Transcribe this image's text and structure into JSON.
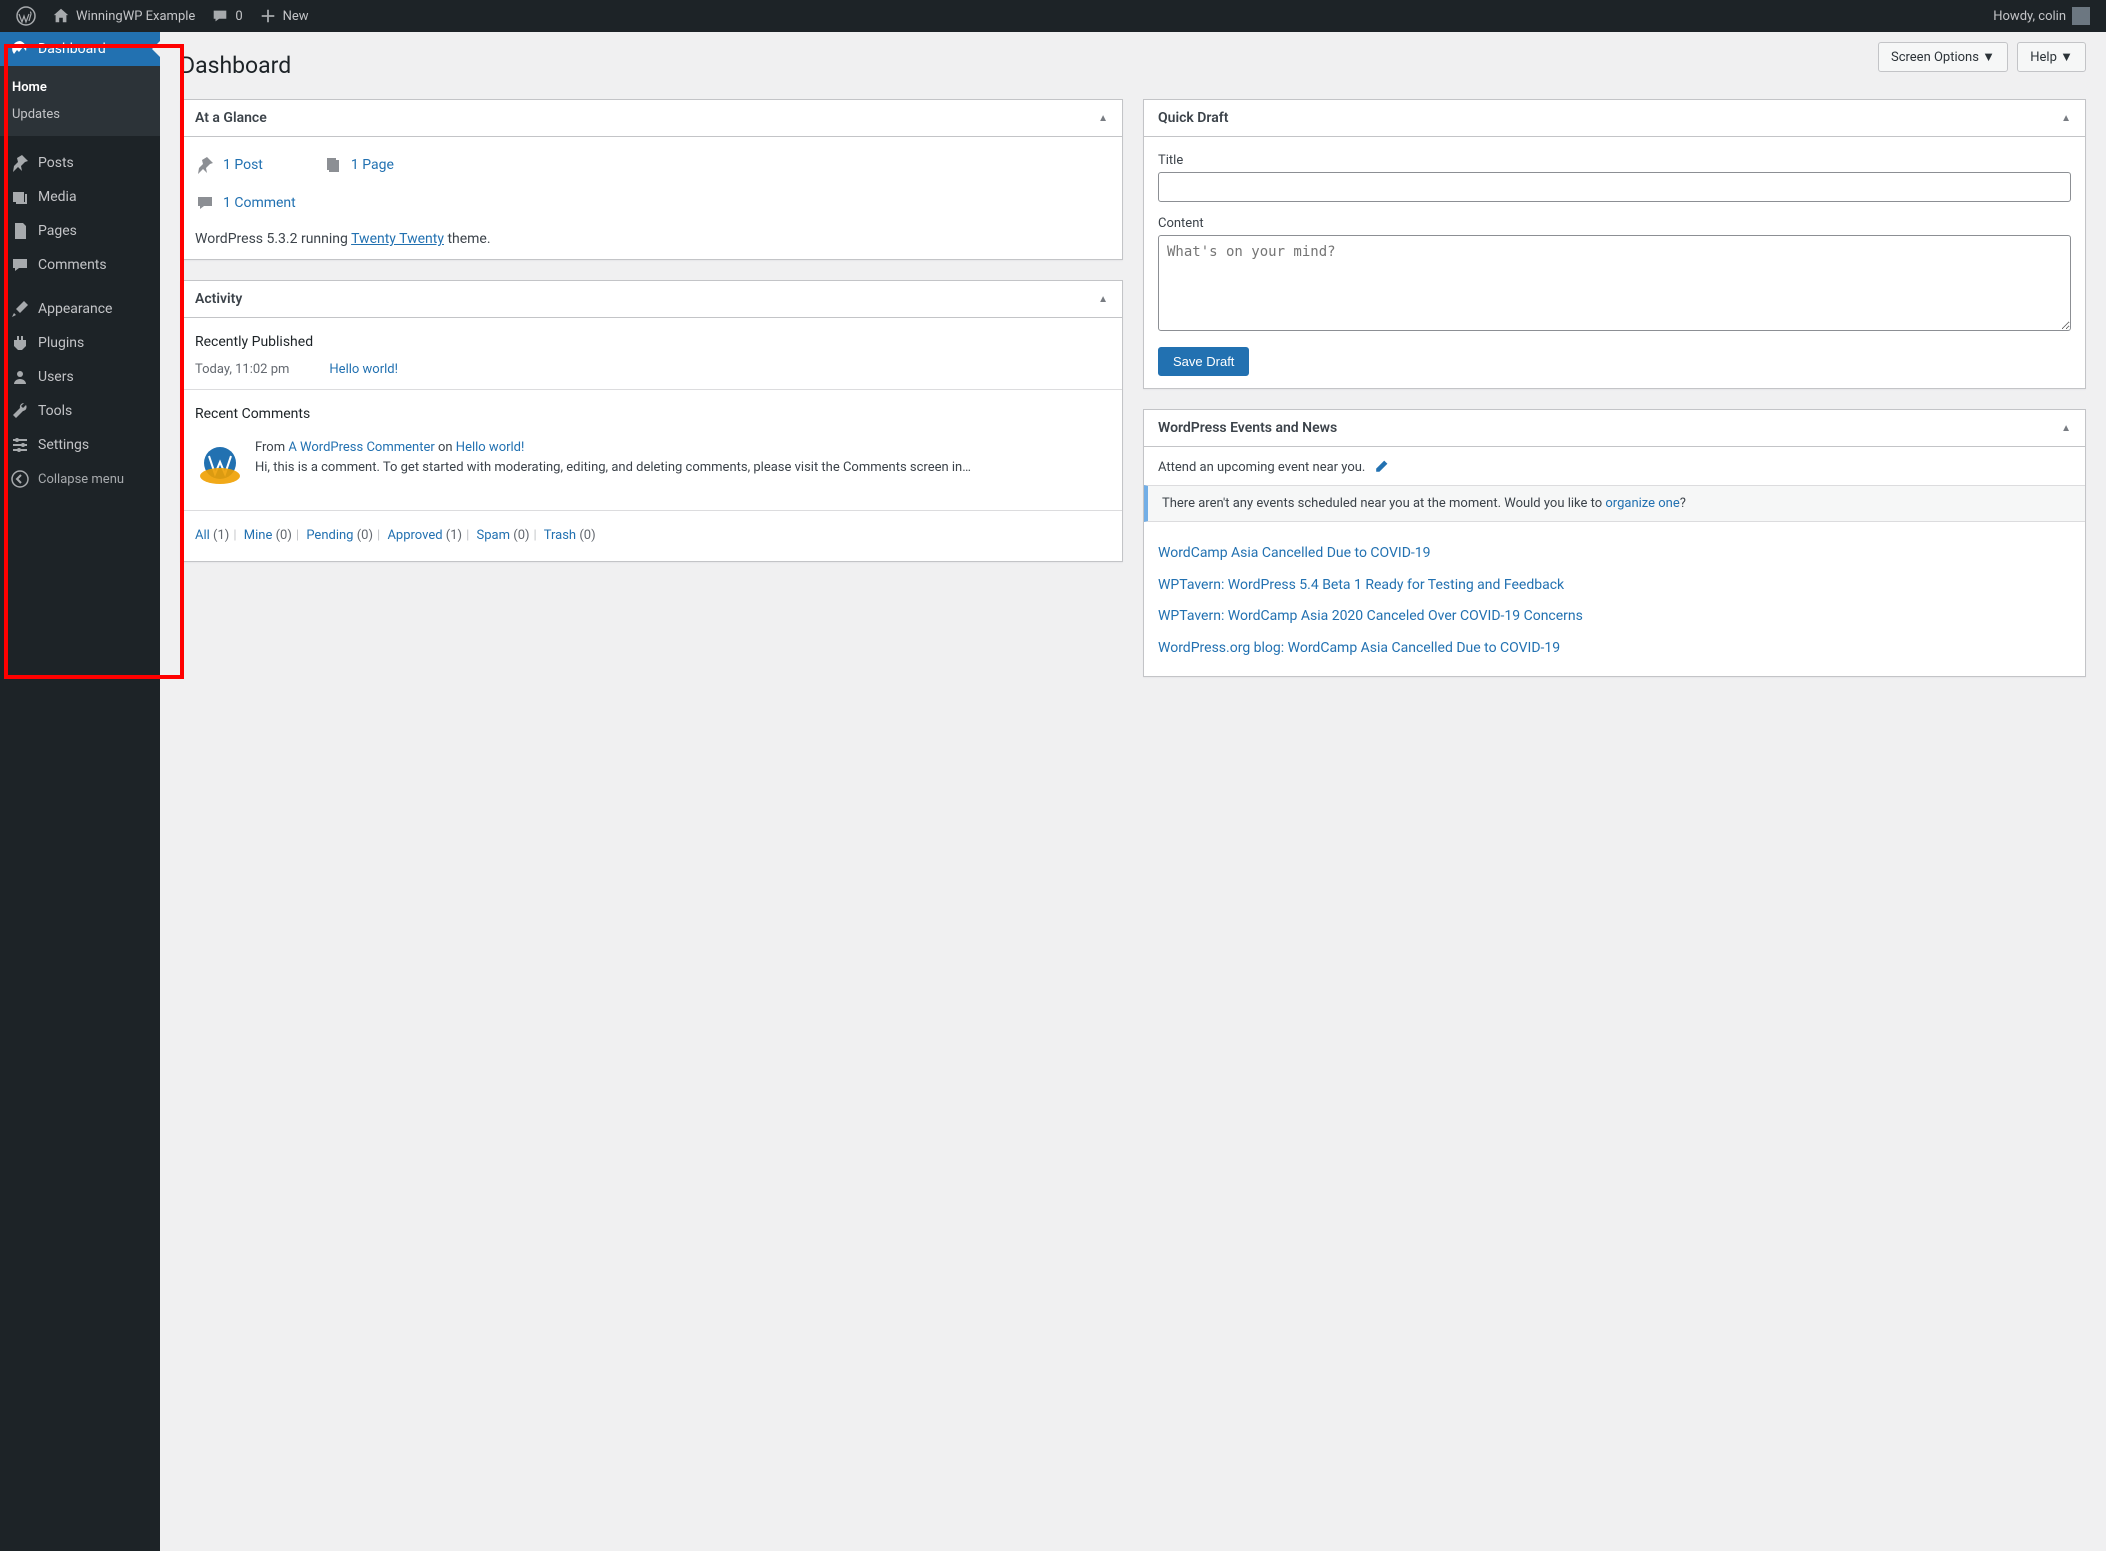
{
  "adminbar": {
    "site_name": "WinningWP Example",
    "comments_count": "0",
    "new_label": "New",
    "howdy": "Howdy, colin"
  },
  "sidebar": {
    "items": [
      {
        "label": "Dashboard"
      },
      {
        "label": "Posts"
      },
      {
        "label": "Media"
      },
      {
        "label": "Pages"
      },
      {
        "label": "Comments"
      },
      {
        "label": "Appearance"
      },
      {
        "label": "Plugins"
      },
      {
        "label": "Users"
      },
      {
        "label": "Tools"
      },
      {
        "label": "Settings"
      }
    ],
    "submenu": {
      "home": "Home",
      "updates": "Updates"
    },
    "collapse": "Collapse menu"
  },
  "header": {
    "screen_options": "Screen Options",
    "help": "Help",
    "title": "Dashboard"
  },
  "glance": {
    "title": "At a Glance",
    "posts": "1 Post",
    "pages": "1 Page",
    "comments": "1 Comment",
    "version_pre": "WordPress 5.3.2 running ",
    "theme": "Twenty Twenty",
    "version_post": " theme."
  },
  "activity": {
    "title": "Activity",
    "recently_published": "Recently Published",
    "pub_time": "Today, 11:02 pm",
    "pub_title": "Hello world!",
    "recent_comments": "Recent Comments",
    "comment_from": "From ",
    "comment_author": "A WordPress Commenter",
    "comment_on": " on ",
    "comment_post": "Hello world!",
    "comment_text": "Hi, this is a comment. To get started with moderating, editing, and deleting comments, please visit the Comments screen in…",
    "filters": {
      "all": "All",
      "all_n": "(1)",
      "mine": "Mine",
      "mine_n": "(0)",
      "pending": "Pending",
      "pending_n": "(0)",
      "approved": "Approved",
      "approved_n": "(1)",
      "spam": "Spam",
      "spam_n": "(0)",
      "trash": "Trash",
      "trash_n": "(0)"
    }
  },
  "quickdraft": {
    "title": "Quick Draft",
    "title_label": "Title",
    "content_label": "Content",
    "content_placeholder": "What's on your mind?",
    "save": "Save Draft"
  },
  "events": {
    "title": "WordPress Events and News",
    "attend": "Attend an upcoming event near you.",
    "no_events_pre": "There aren't any events scheduled near you at the moment. Would you like to ",
    "organize": "organize one",
    "no_events_post": "?",
    "news": [
      "WordCamp Asia Cancelled Due to COVID-19",
      "WPTavern: WordPress 5.4 Beta 1 Ready for Testing and Feedback",
      "WPTavern: WordCamp Asia 2020 Canceled Over COVID-19 Concerns",
      "WordPress.org blog: WordCamp Asia Cancelled Due to COVID-19"
    ]
  }
}
